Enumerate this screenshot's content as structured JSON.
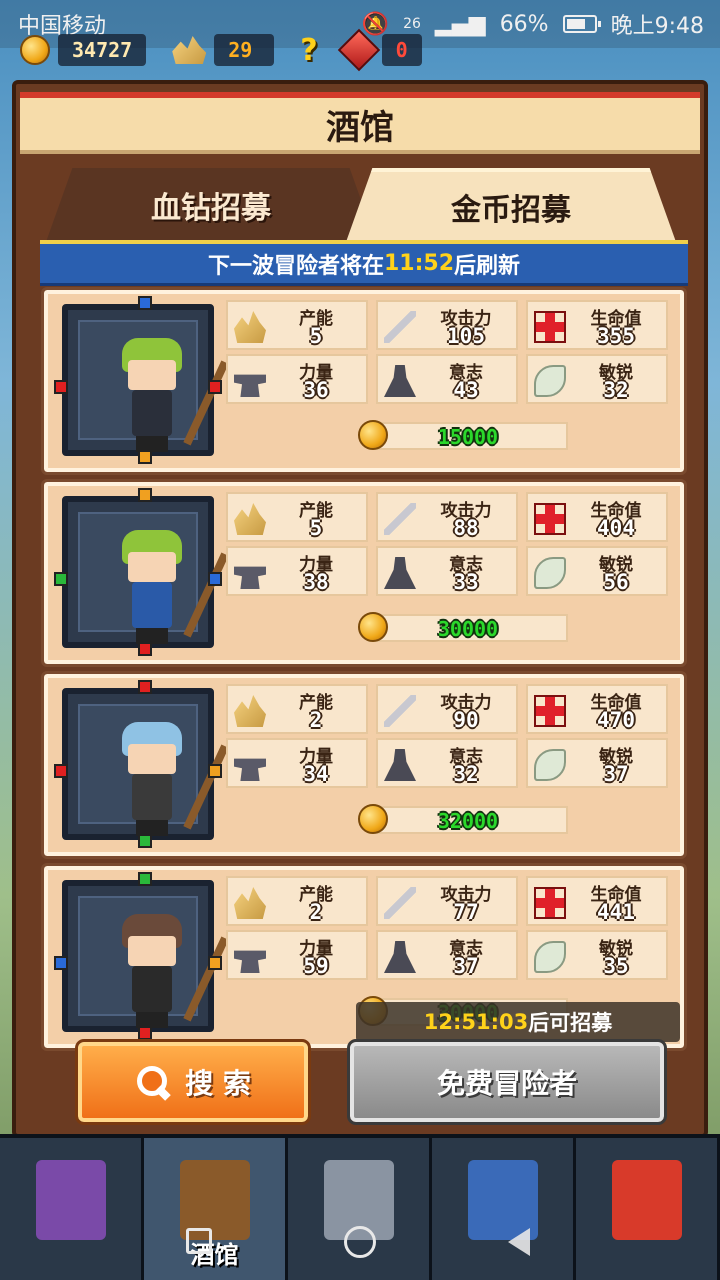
{
  "status_bar": {
    "carrier": "中国移动",
    "signal": "26",
    "battery": "66%",
    "time": "晚上9:48"
  },
  "resources": {
    "gold": "34727",
    "ore": "29",
    "gems": "0"
  },
  "panel": {
    "title": "酒馆",
    "tabs": [
      {
        "label": "血钻招募",
        "active": false
      },
      {
        "label": "金币招募",
        "active": true
      }
    ],
    "notice_prefix": "下一波冒险者将在",
    "notice_time": "11:52",
    "notice_suffix": "后刷新"
  },
  "stat_labels": {
    "production": "产能",
    "attack": "攻击力",
    "health": "生命值",
    "strength": "力量",
    "will": "意志",
    "agility": "敏锐"
  },
  "adventurers": [
    {
      "production": "5",
      "attack": "105",
      "health": "355",
      "strength": "36",
      "will": "43",
      "agility": "32",
      "price": "15000",
      "hair": "#8fc43a",
      "outfit": "#2a2f3a",
      "dots": {
        "top": "#2a6ad8",
        "left": "#e02020",
        "right": "#e02020",
        "bottom": "#f0a020"
      }
    },
    {
      "production": "5",
      "attack": "88",
      "health": "404",
      "strength": "38",
      "will": "33",
      "agility": "56",
      "price": "30000",
      "hair": "#8fc43a",
      "outfit": "#2a5aa8",
      "dots": {
        "top": "#f0a020",
        "left": "#2ab83a",
        "right": "#2a6ad8",
        "bottom": "#e02020"
      }
    },
    {
      "production": "2",
      "attack": "90",
      "health": "470",
      "strength": "34",
      "will": "32",
      "agility": "37",
      "price": "32000",
      "hair": "#8fc2e4",
      "outfit": "#3a3a3a",
      "dots": {
        "top": "#e02020",
        "left": "#e02020",
        "right": "#f0a020",
        "bottom": "#2ab83a"
      }
    },
    {
      "production": "2",
      "attack": "77",
      "health": "441",
      "strength": "59",
      "will": "37",
      "agility": "35",
      "price": "30000",
      "hair": "#6a4a3a",
      "outfit": "#2a2a2a",
      "dots": {
        "top": "#2ab83a",
        "left": "#2a6ad8",
        "right": "#f0a020",
        "bottom": "#e02020"
      }
    }
  ],
  "cooldown": {
    "time": "12:51:03",
    "suffix": "后可招募"
  },
  "buttons": {
    "search": "搜 索",
    "free": "免费冒险者"
  },
  "bottom_nav": [
    {
      "icon": "barracks-helmet-icon",
      "label": "",
      "color": "#7a4aa8"
    },
    {
      "icon": "tavern-mug-icon",
      "label": "酒馆",
      "color": "#8a5a2a",
      "active": true
    },
    {
      "icon": "castle-tower-icon",
      "label": "",
      "color": "#8a94a2"
    },
    {
      "icon": "crossed-swords-shield-icon",
      "label": "",
      "color": "#3a6ab8"
    },
    {
      "icon": "gem-coin-shop-icon",
      "label": "",
      "color": "#d83a2a"
    }
  ]
}
